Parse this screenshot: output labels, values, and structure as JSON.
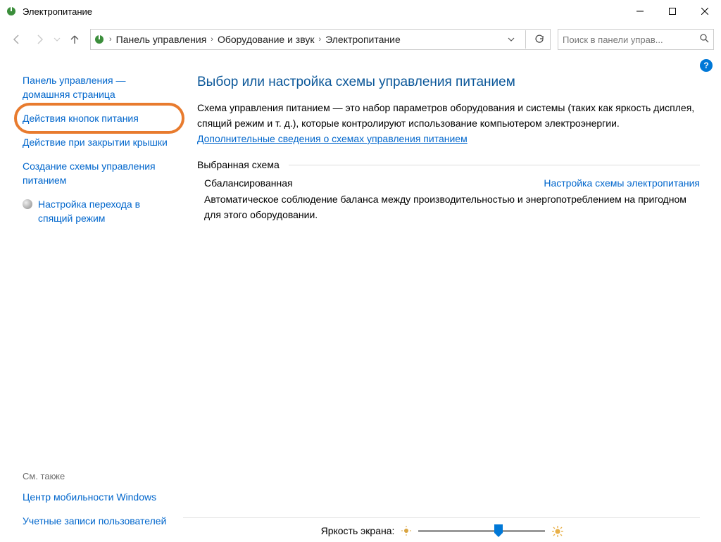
{
  "window": {
    "title": "Электропитание"
  },
  "breadcrumb": {
    "0": "Панель управления",
    "1": "Оборудование и звук",
    "2": "Электропитание"
  },
  "search": {
    "placeholder": "Поиск в панели управ..."
  },
  "sidebar": {
    "home": "Панель управления — домашняя страница",
    "links": {
      "0": "Действия кнопок питания",
      "1": "Действие при закрытии крышки",
      "2": "Создание схемы управления питанием",
      "3": "Настройка перехода в спящий режим"
    },
    "see_also_label": "См. также",
    "see_also": {
      "0": "Центр мобильности Windows",
      "1": "Учетные записи пользователей"
    }
  },
  "main": {
    "title": "Выбор или настройка схемы управления питанием",
    "desc_1": "Схема управления питанием — это набор параметров оборудования и системы (таких как яркость дисплея, спящий режим и т. д.), которые контролируют использование компьютером электроэнергии. ",
    "desc_link": "Дополнительные сведения о схемах управления питанием",
    "selected_label": "Выбранная схема",
    "plan_name": "Сбалансированная",
    "plan_config": "Настройка схемы электропитания",
    "plan_desc": "Автоматическое соблюдение баланса между производительностью и энергопотреблением на пригодном для этого оборудовании.",
    "brightness_label": "Яркость экрана:"
  }
}
